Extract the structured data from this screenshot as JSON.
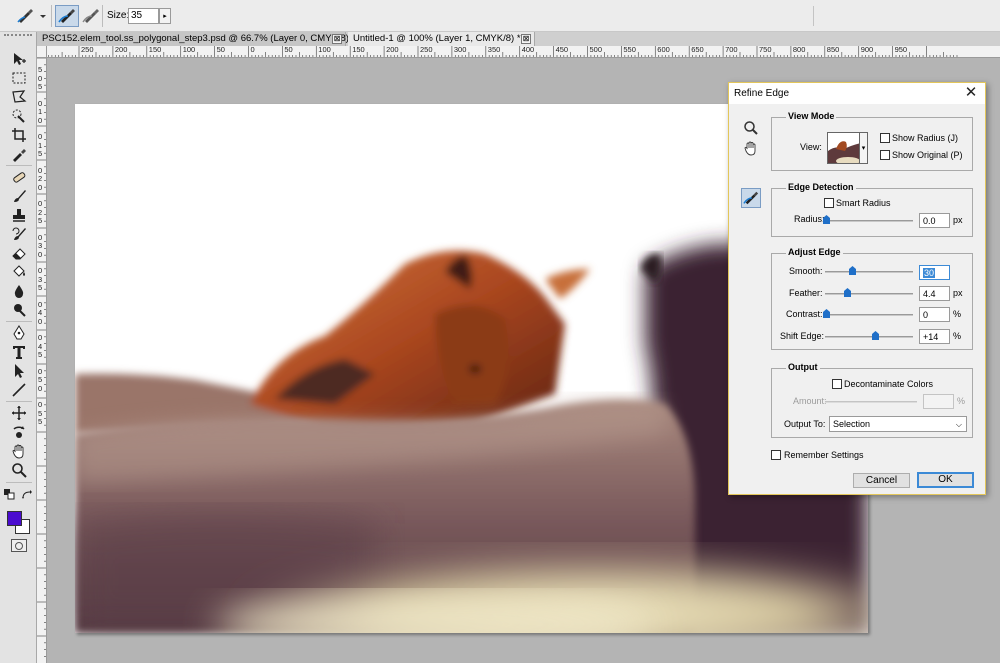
{
  "options_bar": {
    "size_label": "Size:",
    "size_value": "35",
    "size_arrow": "▸"
  },
  "tabs": [
    {
      "label": "PSC152.elem_tool.ss_polygonal_step3.psd @ 66.7% (Layer 0, CMYK/8)",
      "close": "⊠"
    },
    {
      "label": "Untitled-1 @ 100% (Layer 1, CMYK/8) *",
      "close": "⊠"
    }
  ],
  "ruler_h": [
    "250",
    "200",
    "150",
    "100",
    "50",
    "0",
    "50",
    "100",
    "150",
    "200",
    "250",
    "300",
    "350",
    "400",
    "450",
    "500",
    "550",
    "600",
    "650",
    "700",
    "750",
    "800",
    "850",
    "900",
    "950"
  ],
  "ruler_v": [
    "5",
    "0",
    "5",
    "0",
    "1",
    "0",
    "0",
    "1",
    "5",
    "0",
    "2",
    "0",
    "0",
    "2",
    "5",
    "0",
    "3",
    "0",
    "0",
    "3",
    "5",
    "0",
    "4",
    "0",
    "0",
    "4",
    "5",
    "0",
    "5",
    "0",
    "0",
    "5",
    "5"
  ],
  "colors": {
    "foreground": "#4a0ccf",
    "background": "#ffffff",
    "default_button_border": "#3c8ad6",
    "dialog_border": "#e3c65a"
  },
  "dialog": {
    "title": "Refine Edge",
    "close": "✕",
    "view_mode": {
      "title": "View Mode",
      "view_label": "View:",
      "view_drop": "▾",
      "show_radius": "Show Radius (J)",
      "show_original": "Show Original (P)"
    },
    "edge_detection": {
      "title": "Edge Detection",
      "smart_radius": "Smart Radius",
      "radius_label": "Radius:",
      "radius_value": "0.0",
      "radius_unit": "px"
    },
    "adjust_edge": {
      "title": "Adjust Edge",
      "smooth_label": "Smooth:",
      "smooth_value": "30",
      "feather_label": "Feather:",
      "feather_value": "4.4",
      "feather_unit": "px",
      "contrast_label": "Contrast:",
      "contrast_value": "0",
      "contrast_unit": "%",
      "shift_label": "Shift Edge:",
      "shift_value": "+14",
      "shift_unit": "%"
    },
    "output": {
      "title": "Output",
      "decontaminate": "Decontaminate Colors",
      "amount_label": "Amount:",
      "amount_unit": "%",
      "output_to_label": "Output To:",
      "output_to_value": "Selection",
      "output_to_arrow": "⌵"
    },
    "remember": "Remember Settings",
    "cancel": "Cancel",
    "ok": "OK"
  }
}
